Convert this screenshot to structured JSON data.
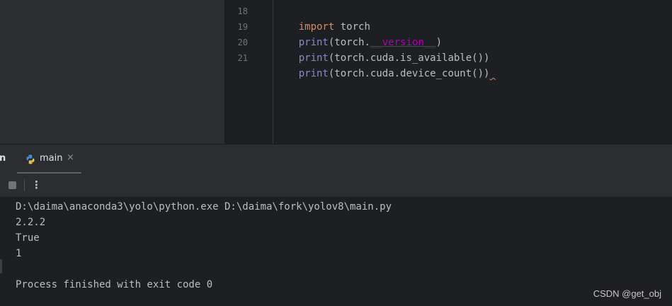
{
  "editor": {
    "lines": [
      {
        "num": "18",
        "parts": [
          {
            "text": "import",
            "cls": "kw"
          },
          {
            "text": " torch",
            "cls": ""
          }
        ]
      },
      {
        "num": "19",
        "parts": [
          {
            "text": "print",
            "cls": "fn"
          },
          {
            "text": "(torch.",
            "cls": ""
          },
          {
            "text": "__version__",
            "cls": "dunder"
          },
          {
            "text": ")",
            "cls": ""
          }
        ]
      },
      {
        "num": "20",
        "parts": [
          {
            "text": "print",
            "cls": "fn"
          },
          {
            "text": "(torch.cuda.is_available())",
            "cls": ""
          }
        ]
      },
      {
        "num": "21",
        "parts": [
          {
            "text": "print",
            "cls": "fn"
          },
          {
            "text": "(torch.cuda.device_count())",
            "cls": ""
          },
          {
            "text": " ",
            "cls": "squiggle"
          }
        ]
      }
    ]
  },
  "run_panel": {
    "title_fragment": "n",
    "tab": {
      "label": "main",
      "close": "×",
      "icon": "python-icon"
    },
    "toolbar": {
      "stop_icon": "stop-icon",
      "more_icon": "more-vertical-icon",
      "more_glyph": "⋮"
    }
  },
  "console": {
    "lines": [
      "D:\\daima\\anaconda3\\yolo\\python.exe D:\\daima\\fork\\yolov8\\main.py",
      "2.2.2",
      "True",
      "1",
      "",
      "Process finished with exit code 0"
    ]
  },
  "watermark": "CSDN @get_obj",
  "colors": {
    "background": "#1e1f22",
    "panel": "#2b2d30",
    "keyword": "#cf8e6d",
    "builtin": "#8888c6",
    "dunder": "#b200b2"
  }
}
